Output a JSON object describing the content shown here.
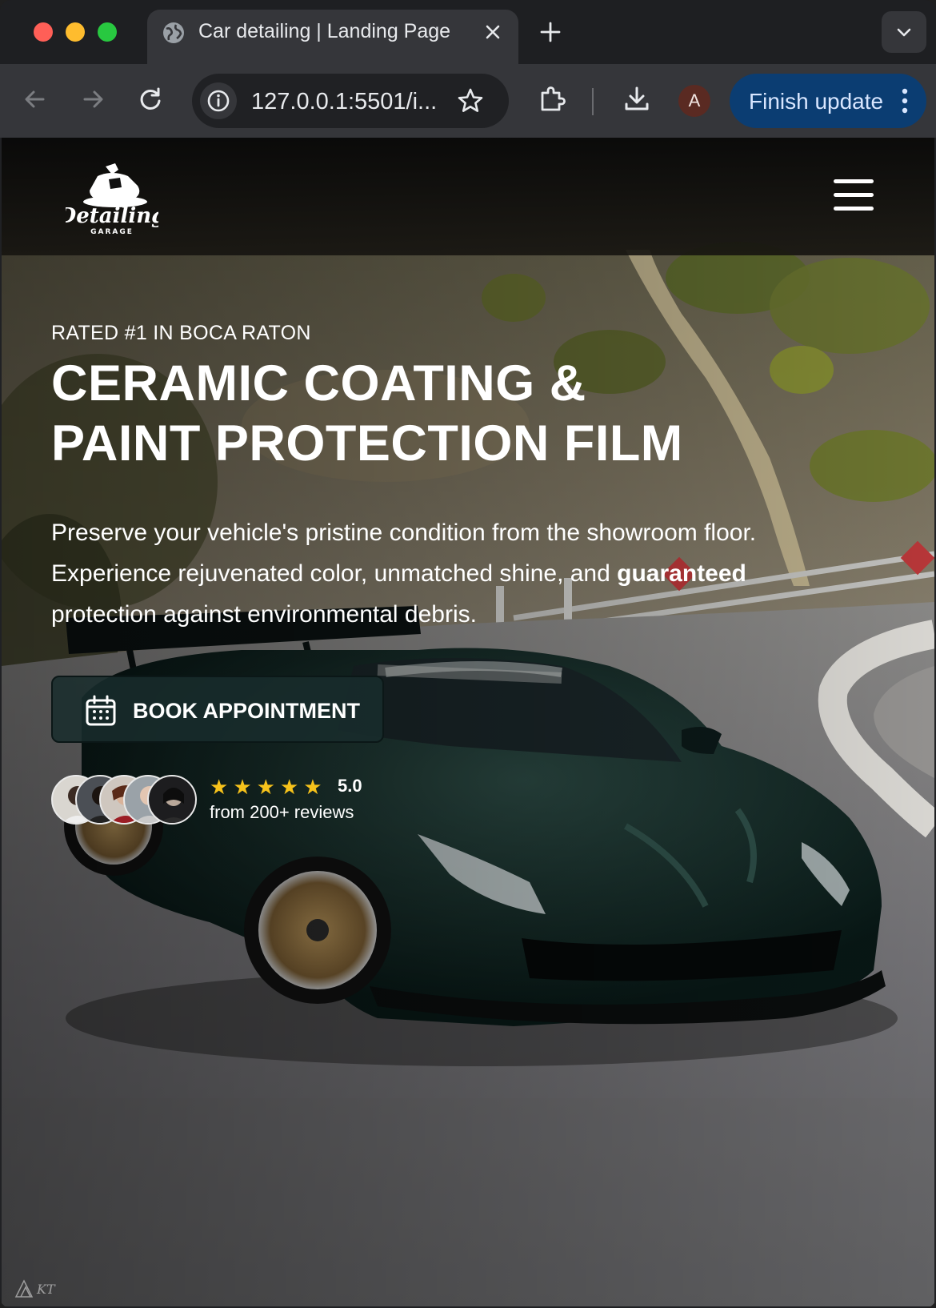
{
  "browser": {
    "tab": {
      "title": "Car detailing | Landing Page"
    },
    "address_bar": {
      "url": "127.0.0.1:5501/i..."
    },
    "profile_initial": "A",
    "update_button": {
      "label": "Finish update"
    }
  },
  "site": {
    "logo": {
      "wordmark": "Detailing",
      "sub": "GARAGE"
    },
    "hero": {
      "eyebrow": "RATED #1 IN BOCA RATON",
      "headline": "CERAMIC COATING &\nPAINT PROTECTION FILM",
      "lead_start": "Preserve your vehicle's pristine condition from the showroom floor. Experience rejuvenated color, unmatched shine, and ",
      "lead_bold": "guaranteed",
      "lead_end": " protection against environmental debris.",
      "cta_label": "BOOK APPOINTMENT",
      "rating_value": "5.0",
      "stars": 5,
      "reviews_text": "from 200+ reviews",
      "reviewer_count_shown": 5
    },
    "photo_watermark": "KT"
  },
  "colors": {
    "star": "#f6c21b",
    "cta_bg": "#182c2c",
    "car_body": "#0f2a27",
    "update_button_bg": "#0b3d72"
  },
  "icons": {
    "back": "arrow-left-icon",
    "forward": "arrow-right-icon",
    "reload": "reload-icon",
    "info": "info-icon",
    "bookmark": "star-icon",
    "extensions": "puzzle-icon",
    "download": "download-icon",
    "menu": "hamburger-icon",
    "calendar": "calendar-icon"
  }
}
